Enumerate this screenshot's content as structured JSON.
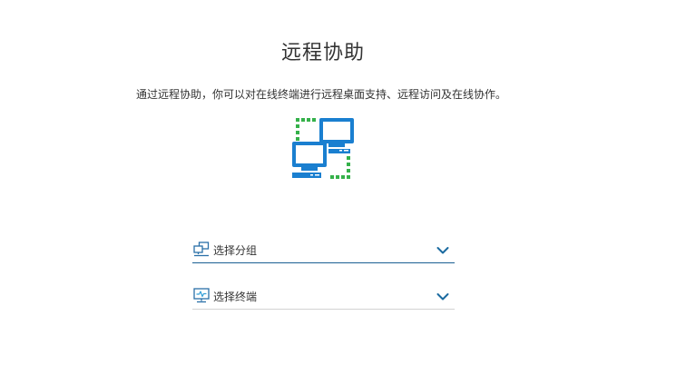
{
  "page": {
    "title": "远程协助",
    "description": "通过远程协助，你可以对在线终端进行远程桌面支持、远程访问及在线协作。",
    "hero_icon": "remote-connection-icon"
  },
  "form": {
    "group_select": {
      "label": "选择分组",
      "icon": "group-network-icon",
      "expand_icon": "chevron-down-icon"
    },
    "terminal_select": {
      "label": "选择终端",
      "icon": "terminal-monitor-icon",
      "expand_icon": "chevron-down-icon"
    }
  },
  "colors": {
    "accent_blue": "#1a7fd0",
    "connector_green": "#35b14a",
    "focus_underline": "#1a5f93",
    "chevron": "#1a6aa0",
    "text": "#333333"
  }
}
